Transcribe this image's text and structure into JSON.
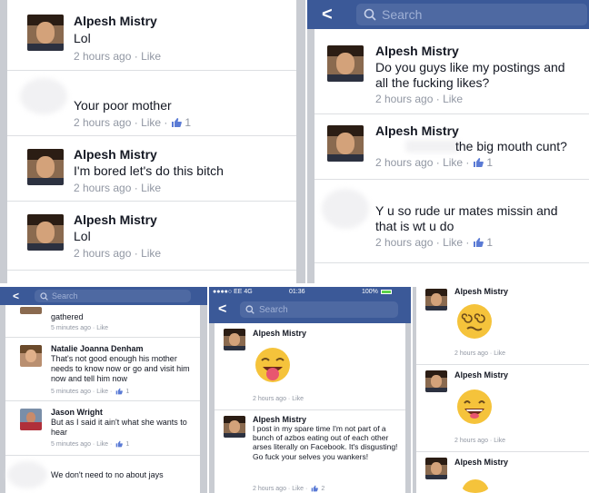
{
  "top_left": {
    "comments": [
      {
        "name": "Alpesh Mistry",
        "text": "Lol",
        "time": "2 hours ago",
        "like": "Like",
        "likes": ""
      },
      {
        "name": "",
        "text": "Your poor mother",
        "time": "2 hours ago",
        "like": "Like",
        "likes": "1"
      },
      {
        "name": "Alpesh Mistry",
        "text": "I'm bored let's do this bitch",
        "time": "2 hours ago",
        "like": "Like",
        "likes": ""
      },
      {
        "name": "Alpesh Mistry",
        "text": "Lol",
        "time": "2 hours ago",
        "like": "Like",
        "likes": ""
      }
    ]
  },
  "top_right": {
    "back": "<",
    "search_placeholder": "Search",
    "comments": [
      {
        "name": "Alpesh Mistry",
        "text": "Do you guys like my postings and all the fucking likes?",
        "time": "2 hours ago",
        "like": "Like",
        "likes": ""
      },
      {
        "name": "Alpesh Mistry",
        "text": "the big mouth cunt?",
        "time": "2 hours ago",
        "like": "Like",
        "likes": "1"
      },
      {
        "name": "",
        "text": "Y u so rude ur mates missin and that is wt u do",
        "time": "2 hours ago",
        "like": "Like",
        "likes": "1"
      }
    ]
  },
  "bottom_left": {
    "back": "<",
    "search_placeholder": "Search",
    "comments": [
      {
        "name": "",
        "text": "gathered",
        "time": "5 minutes ago",
        "like": "Like",
        "likes": ""
      },
      {
        "name": "Natalie Joanna Denham",
        "text": "That's not good enough his mother needs to know now or go and visit him now and tell him now",
        "time": "5 minutes ago",
        "like": "Like",
        "likes": "1"
      },
      {
        "name": "Jason Wright",
        "text": "But as I said it ain't what she wants to hear",
        "time": "5 minutes ago",
        "like": "Like",
        "likes": "1"
      },
      {
        "name": "",
        "text": "We don't need to no about jays",
        "time": "",
        "like": "",
        "likes": ""
      }
    ]
  },
  "bottom_middle": {
    "status": {
      "carrier": "●●●●○ EE  4G",
      "time": "01:36",
      "battery": "100%"
    },
    "back": "<",
    "search_placeholder": "Search",
    "comments": [
      {
        "name": "Alpesh Mistry",
        "text": "",
        "time": "2 hours ago",
        "like": "Like",
        "likes": ""
      },
      {
        "name": "Alpesh Mistry",
        "text": "I post in my spare time I'm not part of a bunch of azbos eating out of each other arses literally on Facebook. It's disgusting! Go fuck your selves you wankers!",
        "time": "2 hours ago",
        "like": "Like",
        "likes": "2"
      }
    ]
  },
  "bottom_right": {
    "comments": [
      {
        "name": "Alpesh Mistry",
        "time": "2 hours ago",
        "like": "Like"
      },
      {
        "name": "Alpesh Mistry",
        "time": "2 hours ago",
        "like": "Like"
      },
      {
        "name": "Alpesh Mistry",
        "time": "",
        "like": ""
      }
    ]
  },
  "colors": {
    "facebook_blue": "#3b5998",
    "meta_gray": "#9197a3",
    "divider": "#dddfe2"
  }
}
